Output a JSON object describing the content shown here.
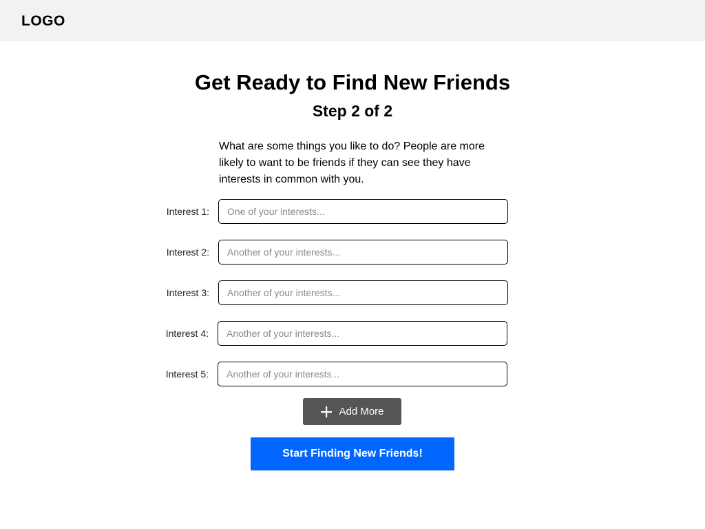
{
  "header": {
    "logo": "LOGO"
  },
  "main": {
    "title": "Get Ready to Find New Friends",
    "step": "Step 2 of 2",
    "description": "What are some things you like to do? People are more likely to want to be friends if they can see they have interests in common with you.",
    "interests": [
      {
        "label": "Interest 1:",
        "value": "",
        "placeholder": "One of your interests..."
      },
      {
        "label": "Interest 2:",
        "value": "",
        "placeholder": "Another of your interests..."
      },
      {
        "label": "Interest 3:",
        "value": "",
        "placeholder": "Another of your interests..."
      },
      {
        "label": "Interest 4:",
        "value": "",
        "placeholder": "Another of your interests..."
      },
      {
        "label": "Interest 5:",
        "value": "",
        "placeholder": "Another of your interests..."
      }
    ],
    "add_more": {
      "label": "Add More",
      "icon": "plus-icon"
    },
    "start_button": {
      "label": "Start Finding New Friends!"
    }
  },
  "colors": {
    "header_bg": "#f2f2f2",
    "add_more_bg": "#555555",
    "primary": "#0066ff"
  }
}
